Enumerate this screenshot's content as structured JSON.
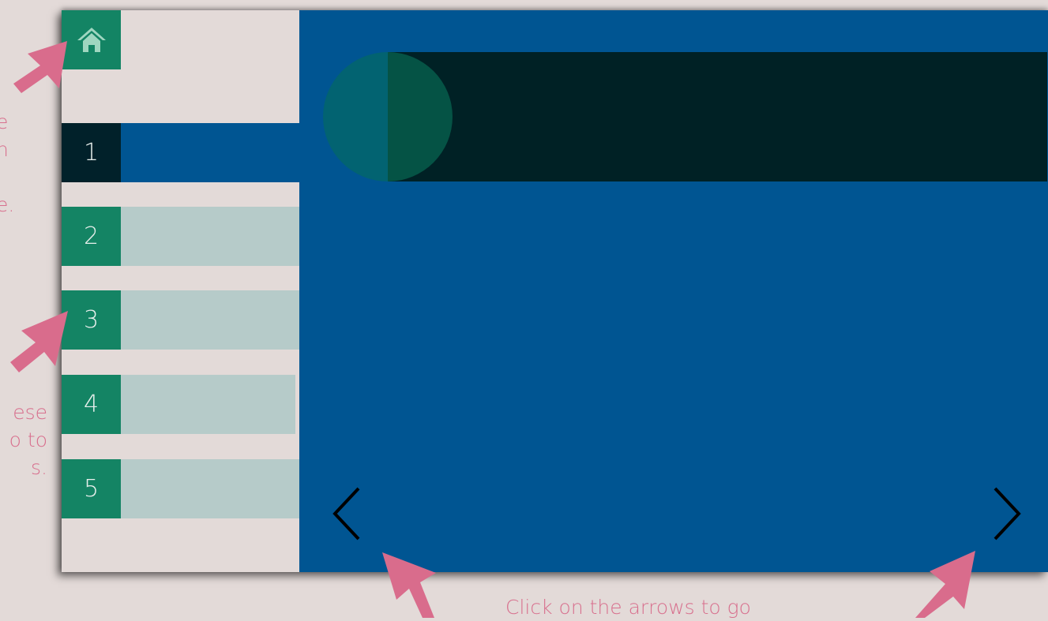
{
  "hints": {
    "home_partial": "e\nn\n\ne.",
    "numbers_partial": "ese\no to\ns.",
    "arrows_partial": "Click on the arrows to go"
  },
  "sidebar": {
    "home_icon": "home-icon",
    "items": [
      {
        "label": "1",
        "active": true
      },
      {
        "label": "2",
        "active": false
      },
      {
        "label": "3",
        "active": false
      },
      {
        "label": "4",
        "active": false
      },
      {
        "label": "5",
        "active": false
      }
    ]
  },
  "navigation": {
    "prev_icon": "chevron-left-icon",
    "next_icon": "chevron-right-icon"
  },
  "colors": {
    "page_background": "#e3dad8",
    "main_blue": "#005592",
    "number_green": "#148464",
    "active_dark": "#01212a",
    "bar_pale": "#b6cbc9",
    "banner_dark": "#002125",
    "circle_teal": "#026371",
    "circle_green": "#055345",
    "hint_pink": "#d8708e",
    "arrow_pink": "#d96c8c"
  }
}
